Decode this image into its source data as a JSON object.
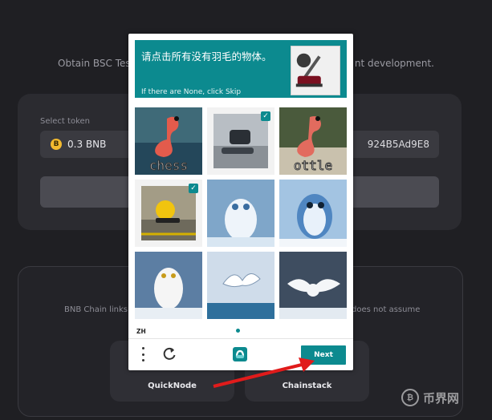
{
  "background": {
    "intro_left": "Obtain BSC Testn",
    "intro_right": "nt development.",
    "select_token_label": "Select token",
    "token_value": "0.3 BNB",
    "token_coin": "B",
    "address_value": "924B5Ad9E8",
    "bottom_text_left": "BNB Chain links to",
    "bottom_text_right": "does not assume",
    "providers": [
      {
        "label": "QuickNode"
      },
      {
        "label": "Chainstack"
      }
    ]
  },
  "captcha": {
    "prompt": "请点击所有没有羽毛的物体。",
    "subtitle": "If there are None, click Skip",
    "tiles": [
      {
        "name": "flamingo-chess",
        "caption": "chess",
        "selected": false
      },
      {
        "name": "vacuum",
        "caption": "",
        "selected": true
      },
      {
        "name": "flamingo-bottle",
        "caption": "ottle",
        "selected": false
      },
      {
        "name": "yellow-vacuum",
        "caption": "",
        "selected": true
      },
      {
        "name": "owl-blue-1",
        "caption": "",
        "selected": false
      },
      {
        "name": "owl-blue-2",
        "caption": "",
        "selected": false
      },
      {
        "name": "snowy-owl",
        "caption": "",
        "selected": false
      },
      {
        "name": "seagull",
        "caption": "",
        "selected": false
      },
      {
        "name": "owl-flying",
        "caption": "",
        "selected": false
      }
    ],
    "language": "ZH",
    "next_label": "Next",
    "accent_color": "#0c8a8f"
  },
  "watermark": {
    "text": "币界网"
  }
}
